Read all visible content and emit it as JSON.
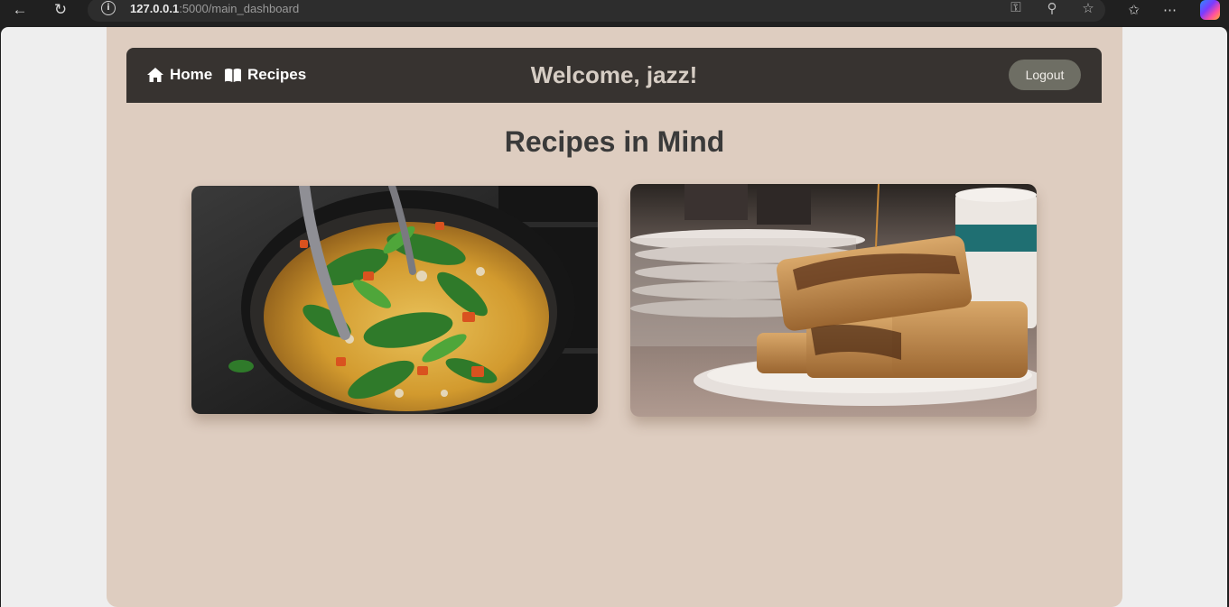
{
  "browser": {
    "url_host": "127.0.0.1",
    "url_path": ":5000/main_dashboard",
    "icons": [
      "back-icon",
      "reload-icon",
      "info-icon",
      "key-icon",
      "zoom-icon",
      "favorite-star-icon",
      "favorites-icon",
      "more-icon",
      "copilot-icon"
    ]
  },
  "navbar": {
    "home_label": "Home",
    "recipes_label": "Recipes",
    "welcome": "Welcome, jazz!",
    "logout_label": "Logout"
  },
  "main": {
    "title": "Recipes in Mind"
  },
  "colors": {
    "page_bg": "#decdc0",
    "navbar_bg": "#373330",
    "logout_bg": "#6e6e64",
    "title": "#3a3a3a"
  }
}
